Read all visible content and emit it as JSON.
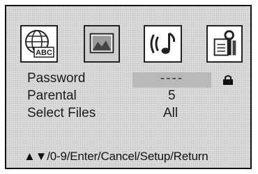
{
  "icons": [
    {
      "name": "language-icon",
      "text": "ABC"
    },
    {
      "name": "picture-icon"
    },
    {
      "name": "audio-icon"
    },
    {
      "name": "setup-icon"
    }
  ],
  "settings": {
    "password": {
      "label": "Password",
      "value": "----"
    },
    "parental": {
      "label": "Parental",
      "value": "5"
    },
    "select_files": {
      "label": "Select Files",
      "value": "All"
    }
  },
  "footer": {
    "arrows": "▲▼",
    "text": "/0-9/Enter/Cancel/Setup/Return"
  },
  "colors": {
    "panel": "#d9d9d9",
    "highlight": "#b9b9b9"
  }
}
